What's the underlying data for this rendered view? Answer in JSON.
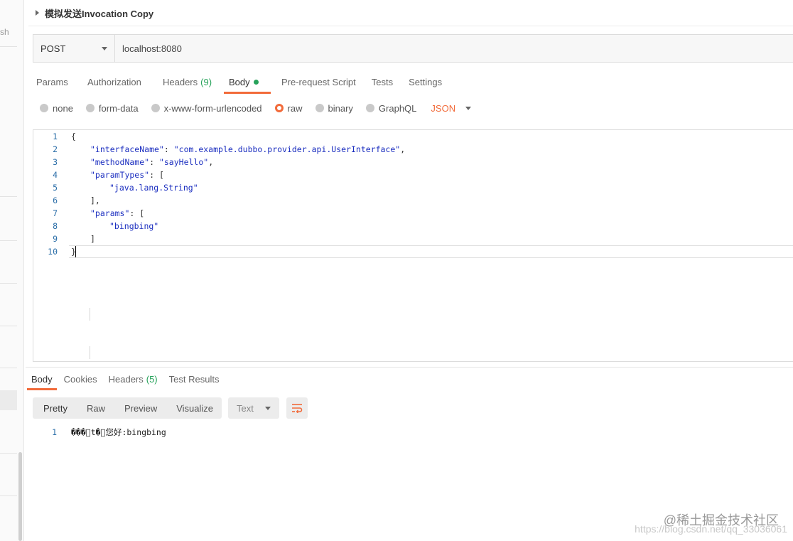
{
  "sidebar": {
    "fragment": "sh"
  },
  "request": {
    "title": "模拟发送Invocation Copy",
    "method": "POST",
    "url": "localhost:8080"
  },
  "req_tabs": {
    "params": "Params",
    "authorization": "Authorization",
    "headers": "Headers",
    "headers_count": "(9)",
    "body": "Body",
    "prerequest": "Pre-request Script",
    "tests": "Tests",
    "settings": "Settings"
  },
  "body_types": {
    "none": "none",
    "form_data": "form-data",
    "urlencoded": "x-www-form-urlencoded",
    "raw": "raw",
    "binary": "binary",
    "graphql": "GraphQL",
    "format": "JSON"
  },
  "editor": {
    "line_numbers": [
      "1",
      "2",
      "3",
      "4",
      "5",
      "6",
      "7",
      "8",
      "9",
      "10"
    ],
    "l1": "{",
    "l2_key": "\"interfaceName\"",
    "l2_sep": ": ",
    "l2_val": "\"com.example.dubbo.provider.api.UserInterface\"",
    "l2_end": ",",
    "l3_key": "\"methodName\"",
    "l3_sep": ": ",
    "l3_val": "\"sayHello\"",
    "l3_end": ",",
    "l4_key": "\"paramTypes\"",
    "l4_rest": ": [",
    "l5_val": "\"java.lang.String\"",
    "l6": "],",
    "l7_key": "\"params\"",
    "l7_rest": ": [",
    "l8_val": "\"bingbing\"",
    "l9": "]",
    "l10": "}"
  },
  "resp_tabs": {
    "body": "Body",
    "cookies": "Cookies",
    "headers": "Headers",
    "headers_count": "(5)",
    "test_results": "Test Results"
  },
  "resp_toolbar": {
    "pretty": "Pretty",
    "raw": "Raw",
    "preview": "Preview",
    "visualize": "Visualize",
    "format": "Text"
  },
  "response": {
    "line_number": "1",
    "text": "���\u0000t�\u0000您好:bingbing"
  },
  "watermark": {
    "brand": "@稀土掘金技术社区",
    "url": "https://blog.csdn.net/qq_33036061"
  },
  "colors": {
    "accent": "#f26b3a",
    "green": "#26a25a"
  }
}
